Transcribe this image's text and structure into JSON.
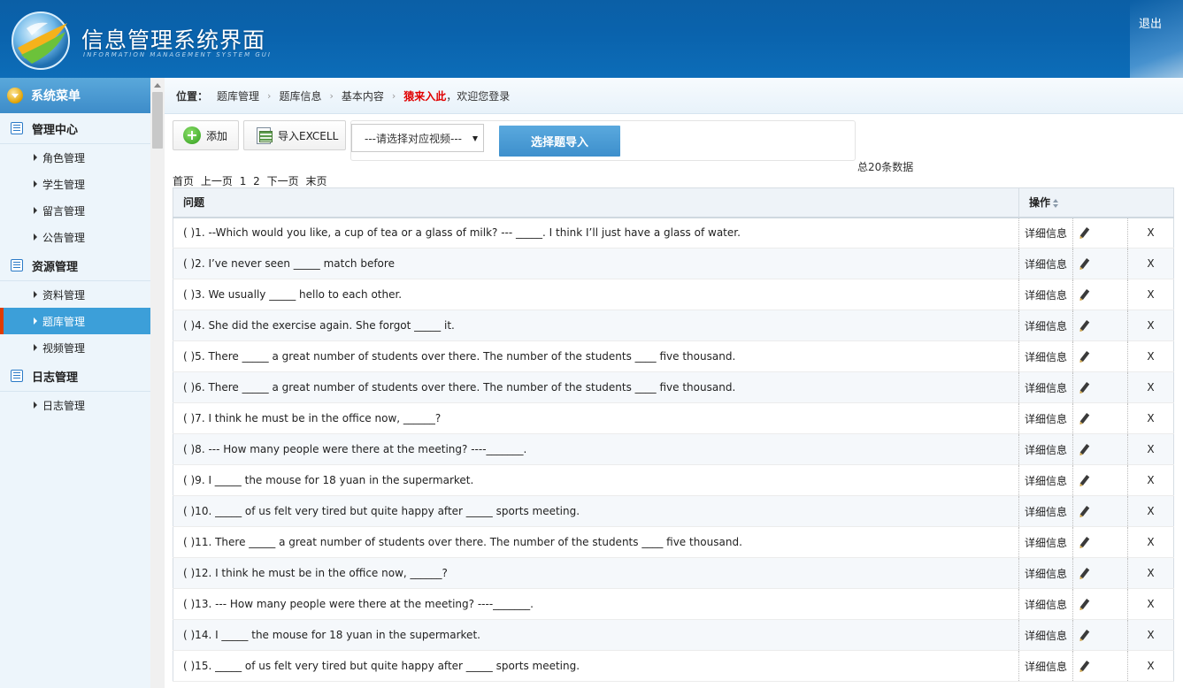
{
  "header": {
    "title": "信息管理系统界面",
    "subtitle": "INFORMATION MANAGEMENT SYSTEM GUI",
    "logout": "退出",
    "colors": {
      "banner": "#0b5fa6",
      "accent": "#3c9fd9",
      "active_marker": "#e03c00"
    }
  },
  "sidebar": {
    "menu_title": "系统菜单",
    "groups": [
      {
        "title": "管理中心",
        "items": [
          "角色管理",
          "学生管理",
          "留言管理",
          "公告管理"
        ]
      },
      {
        "title": "资源管理",
        "items": [
          "资料管理",
          "题库管理",
          "视频管理"
        ]
      },
      {
        "title": "日志管理",
        "items": [
          "日志管理"
        ]
      }
    ],
    "active_item": "题库管理"
  },
  "breadcrumb": {
    "label": "位置：",
    "items": [
      "题库管理",
      "题库信息",
      "基本内容"
    ],
    "username": "猿来入此",
    "welcome": "，欢迎您登录"
  },
  "toolbar": {
    "add": "添加",
    "import_excel": "导入EXCELL",
    "video_select_value": "---请选择对应视频---",
    "import_selected": "选择题导入",
    "add_icon": "plus-circle-icon",
    "excel_icon": "excel-import-icon"
  },
  "stats": {
    "total": "总20条数据"
  },
  "pager": {
    "first": "首页",
    "prev": "上一页",
    "pages": [
      "1",
      "2"
    ],
    "next": "下一页",
    "last": "末页"
  },
  "table": {
    "col_question": "问题",
    "col_actions": "操作",
    "detail_label": "详细信息",
    "delete_label": "X",
    "rows": [
      "( )1. --Which would you like, a cup of tea or a glass of milk? --- _____. I think I’ll just have a glass of water.",
      "( )2. I’ve never seen _____ match before",
      "( )3. We usually _____ hello to each other.",
      "( )4. She did the exercise again. She forgot _____ it.",
      "( )5. There _____ a great number of students over there. The number of the students ____ five thousand.",
      "( )6. There _____ a great number of students over there. The number of the students ____ five thousand.",
      "( )7. I think he must be in the office now, ______?",
      "( )8. --- How many people were there at the meeting? ----_______.",
      "( )9. I _____ the mouse for 18 yuan in the supermarket.",
      "( )10. _____ of us felt very tired but quite happy after _____ sports meeting.",
      "( )11. There _____ a great number of students over there. The number of the students ____ five thousand.",
      "( )12. I think he must be in the office now, ______?",
      "( )13. --- How many people were there at the meeting? ----_______.",
      "( )14. I _____ the mouse for 18 yuan in the supermarket.",
      "( )15. _____ of us felt very tired but quite happy after _____ sports meeting."
    ]
  }
}
